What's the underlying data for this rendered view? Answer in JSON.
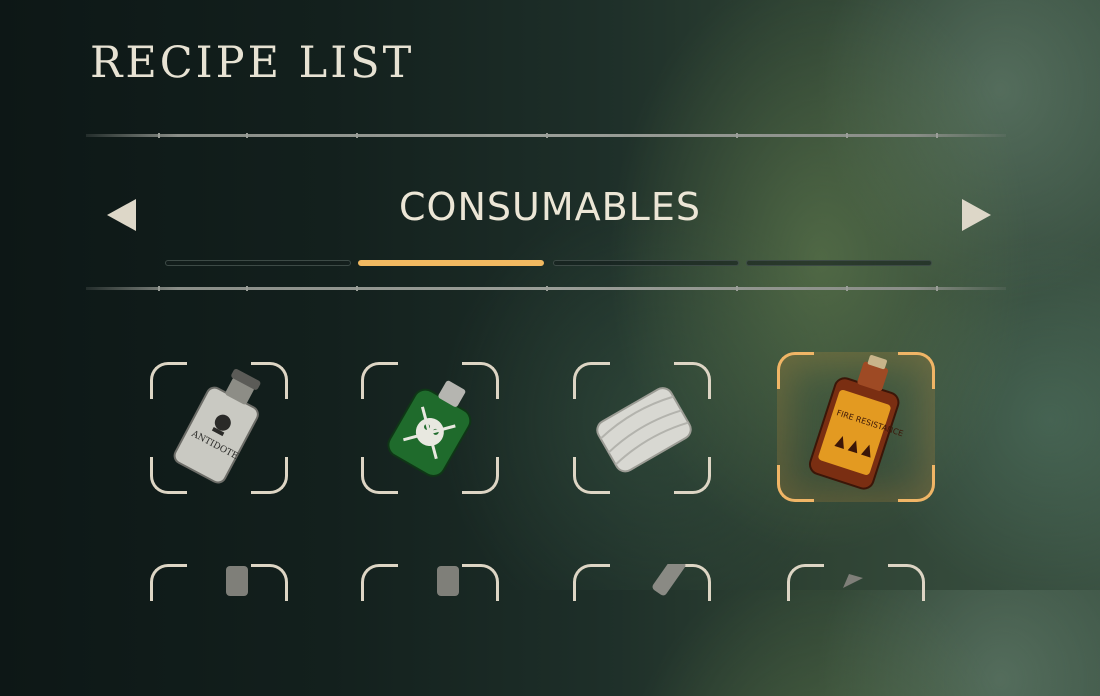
{
  "header": {
    "title": "RECIPE LIST"
  },
  "category_nav": {
    "current": "CONSUMABLES",
    "tab_count": 4,
    "active_tab_index": 1
  },
  "items": [
    {
      "id": "antidote",
      "label": "ANTIDOTE",
      "icon": "antidote-bottle-icon",
      "selected": false
    },
    {
      "id": "poison-flask",
      "label": "",
      "icon": "green-skull-flask-icon",
      "selected": false
    },
    {
      "id": "bandage",
      "label": "",
      "icon": "cloth-bandage-icon",
      "selected": false
    },
    {
      "id": "fire-resistance",
      "label": "FIRE RESISTANCE",
      "icon": "fire-resistance-bottle-icon",
      "selected": true
    }
  ],
  "colors": {
    "accent": "#f1b961",
    "frame": "#ddd5c4",
    "text": "#ece6d6"
  }
}
